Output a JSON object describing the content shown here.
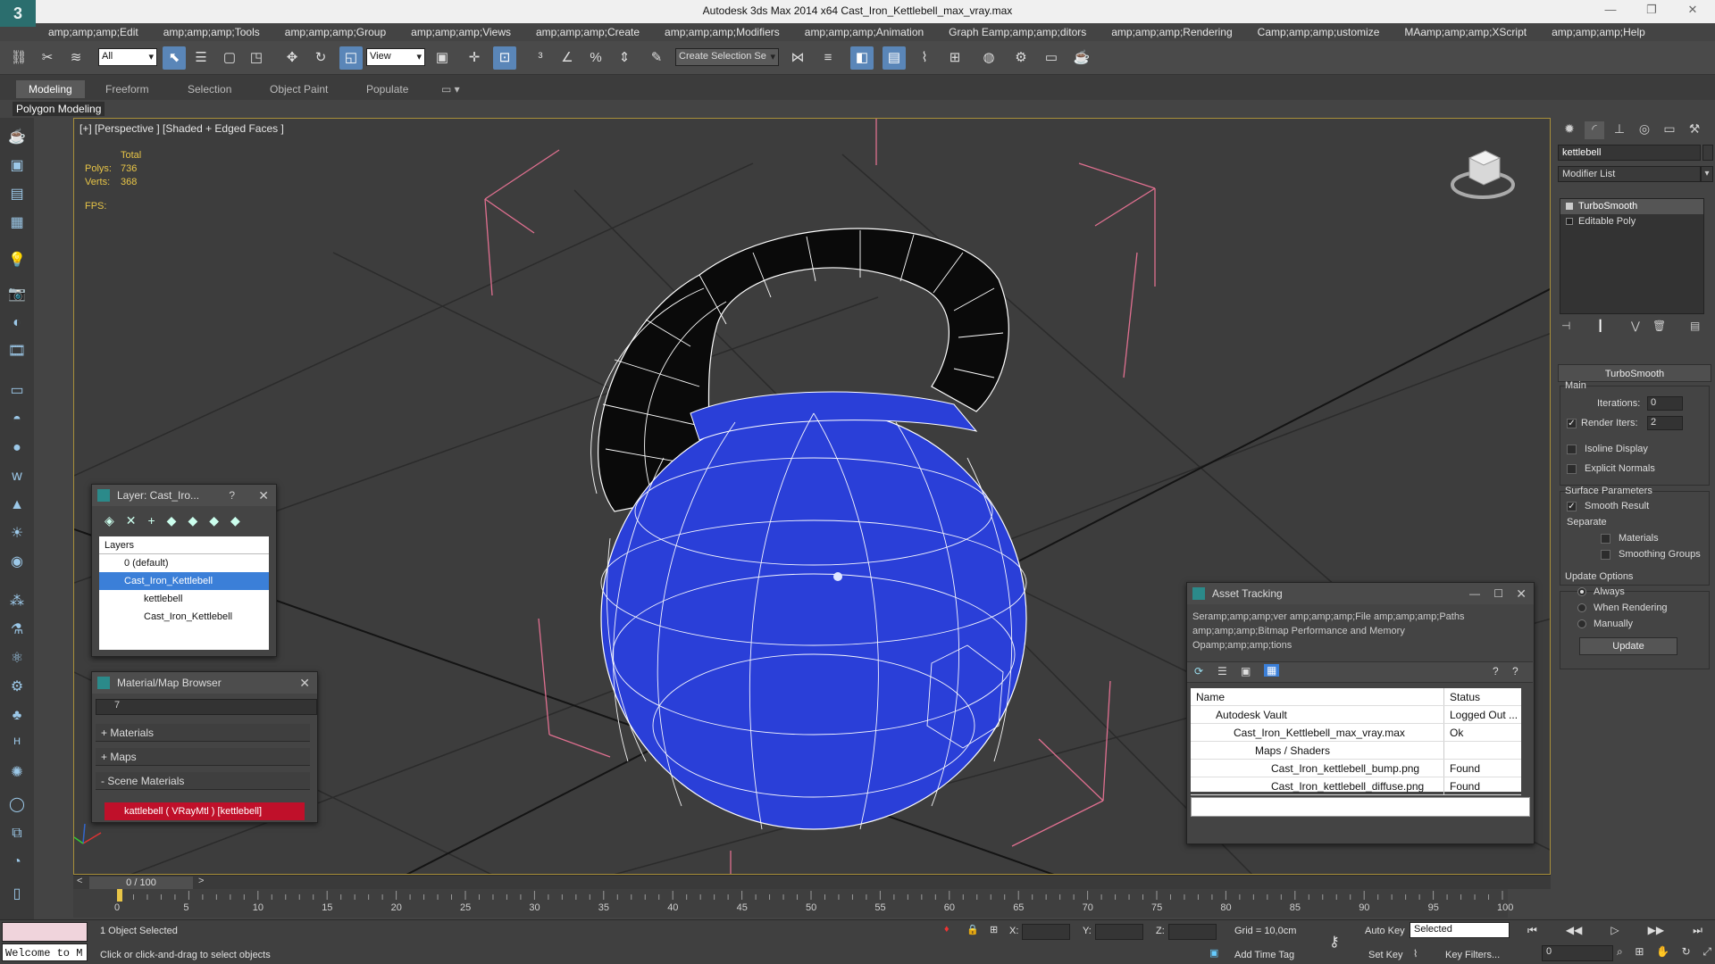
{
  "app": {
    "title": "Autodesk 3ds Max  2014 x64     Cast_Iron_Kettlebell_max_vray.max",
    "logo_glyph": "3",
    "window_controls": [
      "—",
      "❐",
      "✕"
    ]
  },
  "menu": [
    "amp;amp;amp;Edit",
    "amp;amp;amp;Tools",
    "amp;amp;amp;Group",
    "amp;amp;amp;Views",
    "amp;amp;amp;Create",
    "amp;amp;amp;Modifiers",
    "amp;amp;amp;Animation",
    "Graph Eamp;amp;amp;ditors",
    "amp;amp;amp;Rendering",
    "Camp;amp;amp;ustomize",
    "MAamp;amp;amp;XScript",
    "amp;amp;amp;Help"
  ],
  "toolbar": {
    "selection_filter": "All",
    "reference_coord": "View",
    "named_selection_placeholder": "Create Selection Se"
  },
  "ribbon": {
    "tabs": [
      "Modeling",
      "Freeform",
      "Selection",
      "Object Paint",
      "Populate"
    ],
    "active_tab": "Modeling",
    "panel_label": "Polygon Modeling"
  },
  "viewport": {
    "label": "[+] [Perspective ] [Shaded + Edged Faces ]",
    "stats_header": "Total",
    "polys_label": "Polys:",
    "polys_value": "736",
    "verts_label": "Verts:",
    "verts_value": "368",
    "fps_label": "FPS:",
    "mesh_color": "#2a3fd8",
    "handle_color": "#0a0a0a",
    "wire_color": "#ffffff",
    "gizmo_color": "#e07090"
  },
  "layer_dialog": {
    "title": "Layer: Cast_Iro...",
    "help": "?",
    "close": "✕",
    "header": "Layers",
    "items": [
      {
        "label": "0 (default)"
      },
      {
        "label": "Cast_Iron_Kettlebell"
      },
      {
        "label": "kettlebell"
      },
      {
        "label": "Cast_Iron_Kettlebell"
      }
    ]
  },
  "material_browser": {
    "title": "Material/Map Browser",
    "close": "✕",
    "search_value": "7",
    "groups": [
      "+ Materials",
      "+ Maps",
      "- Scene Materials"
    ],
    "entry": "kattlebell  ( VRayMtl ) [kettlebell]",
    "entry_color": "#c0102a"
  },
  "asset_tracking": {
    "title": "Asset Tracking",
    "menus_line1": "Seramp;amp;amp;ver     amp;amp;amp;File     amp;amp;amp;Paths",
    "menus_line2": "amp;amp;amp;Bitmap Performance and Memory",
    "menus_line3": "Opamp;amp;amp;tions",
    "columns": [
      "Name",
      "Status"
    ],
    "rows": [
      {
        "name": "Autodesk Vault",
        "status": "Logged Out ..."
      },
      {
        "name": "Cast_Iron_Kettlebell_max_vray.max",
        "status": "Ok"
      },
      {
        "name": "Maps / Shaders",
        "status": ""
      },
      {
        "name": "Cast_Iron_kettlebell_bump.png",
        "status": "Found"
      },
      {
        "name": "Cast_Iron_kettlebell_diffuse.png",
        "status": "Found"
      }
    ]
  },
  "command_panel": {
    "object_name": "kettlebell",
    "modifier_list": "Modifier List",
    "stack": [
      "TurboSmooth",
      "Editable Poly"
    ],
    "rollout": "TurboSmooth",
    "main_label": "Main",
    "iterations_label": "Iterations:",
    "iterations_value": "0",
    "render_iters_label": "Render Iters:",
    "render_iters_value": "2",
    "isoline": "Isoline Display",
    "explicit_normals": "Explicit Normals",
    "surface_params": "Surface Parameters",
    "smooth_result": "Smooth Result",
    "separate": "Separate",
    "materials": "Materials",
    "smoothing_groups": "Smoothing Groups",
    "update_options": "Update Options",
    "always": "Always",
    "when_rendering": "When Rendering",
    "manually": "Manually",
    "update_button": "Update"
  },
  "timeline": {
    "slider_value": "0 / 100",
    "ticks": [
      "0",
      "5",
      "10",
      "15",
      "20",
      "25",
      "30",
      "35",
      "40",
      "45",
      "50",
      "55",
      "60",
      "65",
      "70",
      "75",
      "80",
      "85",
      "90",
      "95",
      "100"
    ]
  },
  "status": {
    "welcome": "Welcome to M",
    "objects_selected": "1 Object Selected",
    "prompt": "Click or click-and-drag to select objects",
    "x_label": "X:",
    "y_label": "Y:",
    "z_label": "Z:",
    "grid": "Grid = 10,0cm",
    "add_time_tag": "Add Time Tag",
    "auto_key": "Auto Key",
    "set_key": "Set Key",
    "key_mode": "Selected",
    "key_filters": "Key Filters...",
    "frame": "0"
  }
}
